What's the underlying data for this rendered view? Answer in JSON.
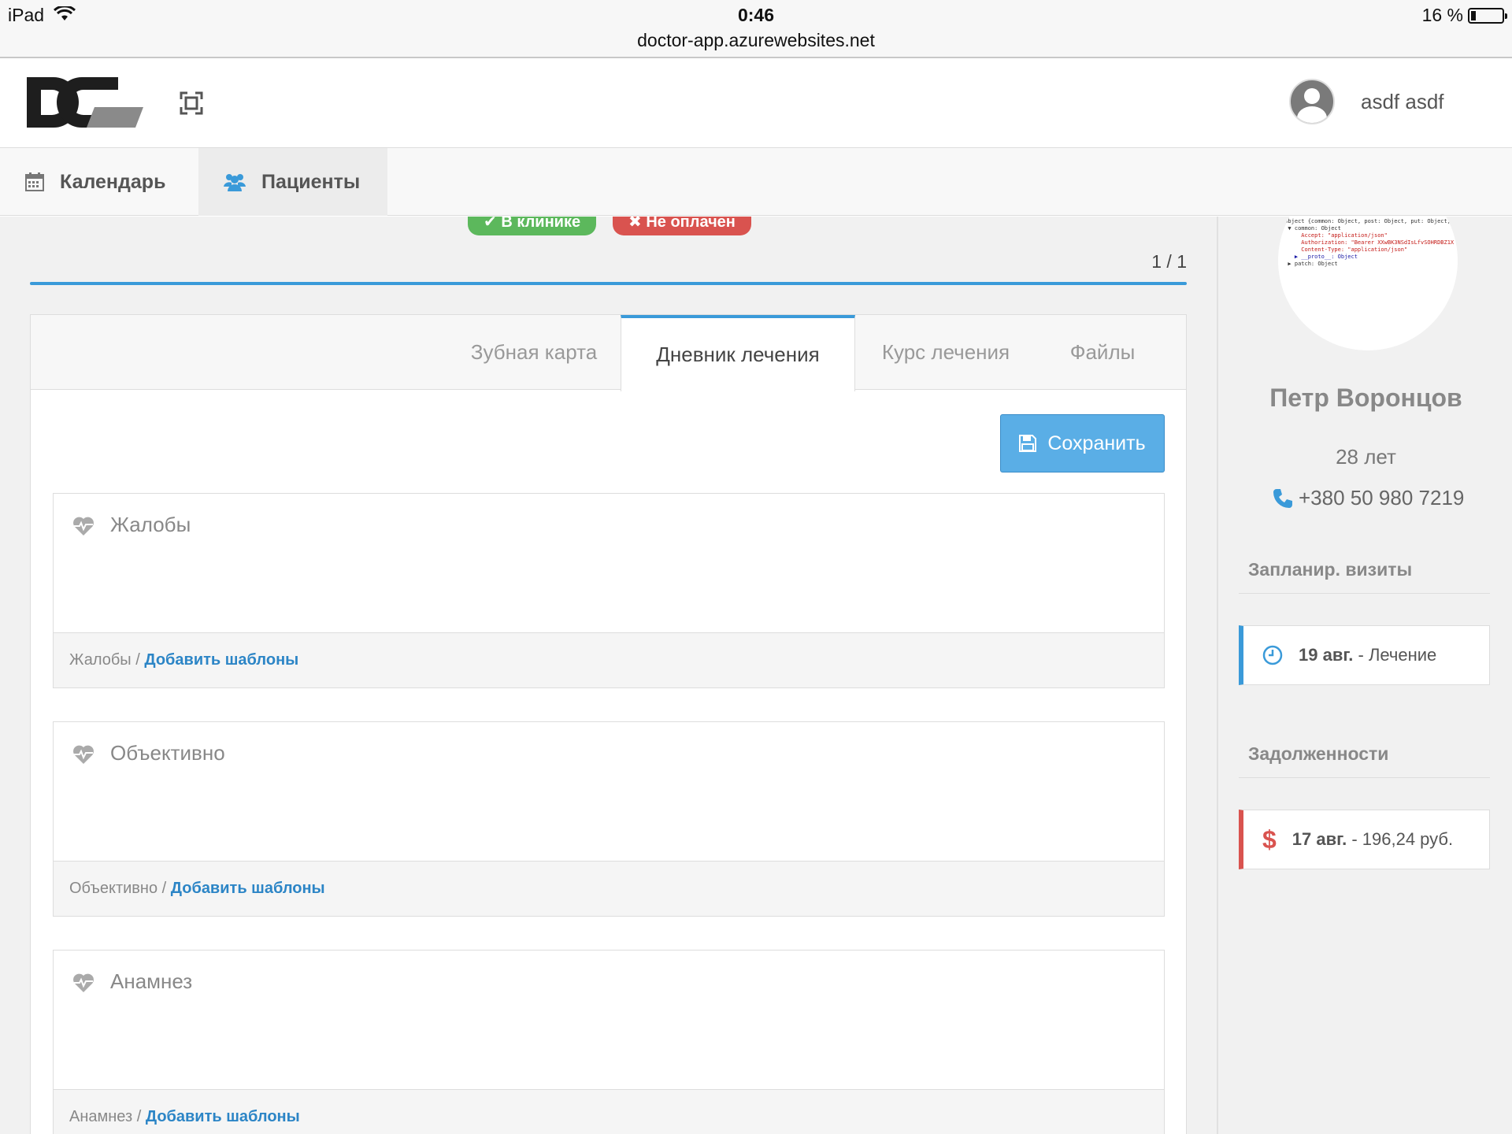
{
  "status_bar": {
    "device": "iPad",
    "time": "0:46",
    "url": "doctor-app.azurewebsites.net",
    "battery": "16 %"
  },
  "header": {
    "username": "asdf asdf"
  },
  "nav": {
    "calendar": "Календарь",
    "patients": "Пациенты"
  },
  "visit": {
    "badge_in_clinic": "✔ В клинике",
    "badge_unpaid": "✖ Не оплачен",
    "counter": "1 / 1"
  },
  "tabs": {
    "dental_chart": "Зубная карта",
    "treatment_diary": "Дневник лечения",
    "treatment_course": "Курс лечения",
    "files": "Файлы",
    "active": "treatment_diary"
  },
  "save_label": "Сохранить",
  "sections": [
    {
      "title": "Жалобы",
      "crumb": "Жалобы / ",
      "link": "Добавить шаблоны"
    },
    {
      "title": "Объективно",
      "crumb": "Объективно / ",
      "link": "Добавить шаблоны"
    },
    {
      "title": "Анамнез",
      "crumb": "Анамнез / ",
      "link": "Добавить шаблоны"
    }
  ],
  "patient": {
    "name": "Петр Воронцов",
    "age": "28 лет",
    "phone": "+380 50 980 7219",
    "photo_text": [
      "▼Object {common: Object, post: Object, put: Object,",
      "  ▼ common: Object",
      "      Accept: \"application/json\"",
      "      Authorization: \"Bearer XXwBK3NSdIsLfvSOHRDBZ1X",
      "      Content-Type: \"application/json\"",
      "    ▶ __proto__: Object",
      "  ▶ patch: Object"
    ]
  },
  "sidebar": {
    "visits_heading": "Запланир. визиты",
    "visit_date": "19 авг.",
    "visit_text": " - Лечение",
    "debts_heading": "Задолженности",
    "debt_date": "17 авг.",
    "debt_text": " - 196,24 руб."
  },
  "colors": {
    "accent": "#3a9ad9",
    "success": "#5cb85c",
    "danger": "#d9534f",
    "link": "#2c85c6"
  }
}
